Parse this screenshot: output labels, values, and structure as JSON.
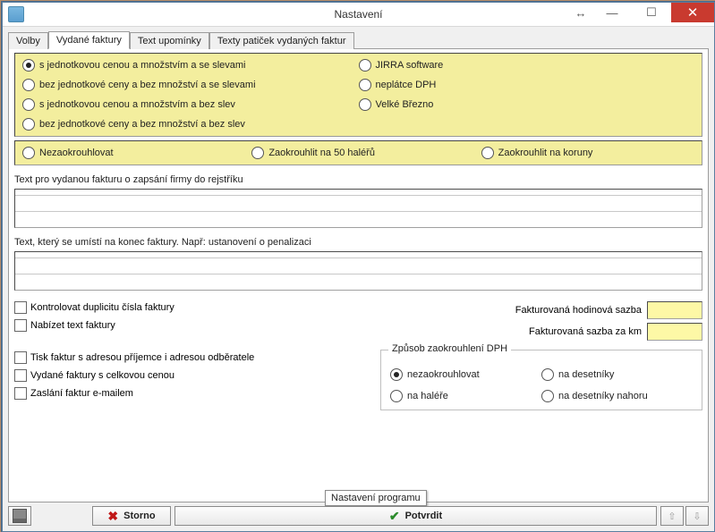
{
  "window": {
    "title": "Nastavení",
    "tooltip": "Nastavení programu"
  },
  "tabs": {
    "t0": "Volby",
    "t1": "Vydané faktury",
    "t2": "Text upomínky",
    "t3": "Texty patiček vydaných faktur",
    "active": 1
  },
  "format_radios": {
    "a": "s jednotkovou cenou a množstvím a se slevami",
    "b": "bez jednotkové ceny a bez množství a se slevami",
    "c": "s jednotkovou cenou a množstvím a bez slev",
    "d": "bez jednotkové ceny a bez množství a bez slev",
    "e": "JIRRA software",
    "f": "neplátce DPH",
    "g": "Velké Březno",
    "selected": "a"
  },
  "round_radios": {
    "a": "Nezaokrouhlovat",
    "b": "Zaokrouhlit na 50 haléřů",
    "c": "Zaokrouhlit na koruny",
    "selected": null
  },
  "labels": {
    "text1": "Text pro vydanou fakturu o zapsání firmy do rejstříku",
    "text2": "Text, který se umístí na konec faktury. Např: ustanovení o penalizaci"
  },
  "checks": {
    "dup": "Kontrolovat duplicitu čísla faktury",
    "offer": "Nabízet text faktury",
    "print": "Tisk faktur s adresou příjemce i adresou odběratele",
    "total": "Vydané faktury s celkovou cenou",
    "email": "Zaslání faktur e-mailem"
  },
  "rates": {
    "hour": "Fakturovaná hodinová sazba",
    "km": "Fakturovaná sazba za km",
    "hour_val": "",
    "km_val": ""
  },
  "dph": {
    "legend": "Způsob zaokrouhlení DPH",
    "a": "nezaokrouhlovat",
    "b": "na desetníky",
    "c": "na haléře",
    "d": "na desetníky nahoru",
    "selected": "a"
  },
  "text1_value": "",
  "text2_value": "",
  "buttons": {
    "storno": "Storno",
    "confirm": "Potvrdit"
  }
}
